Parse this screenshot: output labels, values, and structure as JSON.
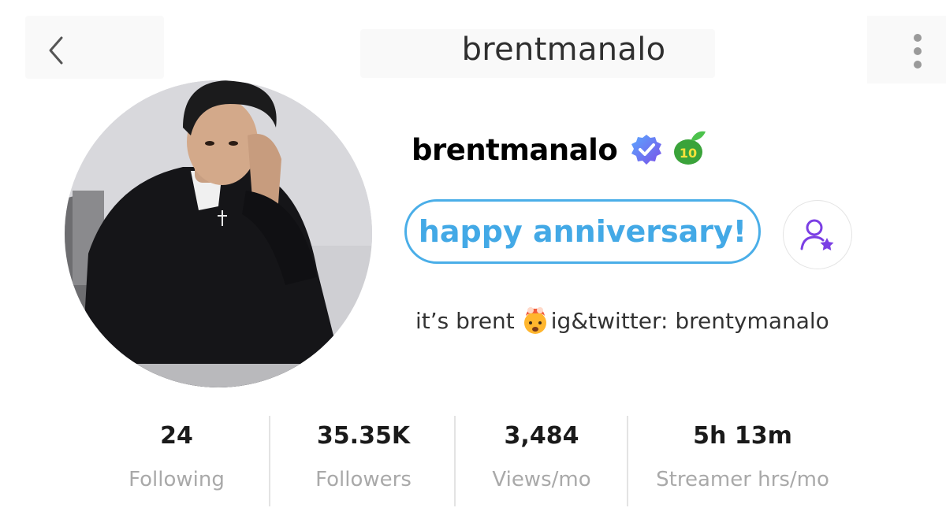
{
  "header": {
    "title": "brentmanalo",
    "back_icon": "chevron-left-icon",
    "more_icon": "more-vertical-icon"
  },
  "profile": {
    "avatar": "profile-photo",
    "username": "brentmanalo",
    "verified_icon": "verified-badge-icon",
    "subscriber_badge": "10",
    "chip_label": "happy anniversary!",
    "follow_icon": "user-star-icon",
    "bio_prefix": "it’s brent",
    "bio_emoji": "exploding-head-emoji",
    "bio_suffix": "ig&twitter: brentymanalo"
  },
  "stats": [
    {
      "value": "24",
      "label": "Following"
    },
    {
      "value": "35.35K",
      "label": "Followers"
    },
    {
      "value": "3,484",
      "label": "Views/mo"
    },
    {
      "value": "5h 13m",
      "label": "Streamer hrs/mo"
    }
  ],
  "colors": {
    "accent_blue": "#43a9e6",
    "verified_blue": "#4a8ff0",
    "purple": "#7b3fe4",
    "badge_green": "#3aa33a"
  }
}
